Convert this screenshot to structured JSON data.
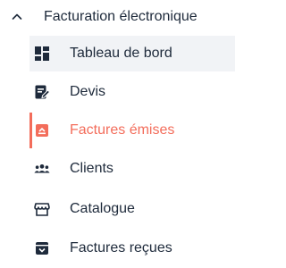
{
  "section": {
    "title": "Facturation électronique",
    "expanded": true
  },
  "colors": {
    "text": "#1e2a3b",
    "accent": "#f36d5b",
    "hover_bg": "#f1f3f6"
  },
  "menu": {
    "items": [
      {
        "label": "Tableau de bord",
        "icon": "dashboard-icon",
        "state": "hovered"
      },
      {
        "label": "Devis",
        "icon": "quote-edit-icon",
        "state": "normal"
      },
      {
        "label": "Factures émises",
        "icon": "invoice-out-icon",
        "state": "active"
      },
      {
        "label": "Clients",
        "icon": "clients-icon",
        "state": "normal"
      },
      {
        "label": "Catalogue",
        "icon": "store-icon",
        "state": "normal"
      },
      {
        "label": "Factures reçues",
        "icon": "invoice-in-icon",
        "state": "normal"
      }
    ]
  }
}
